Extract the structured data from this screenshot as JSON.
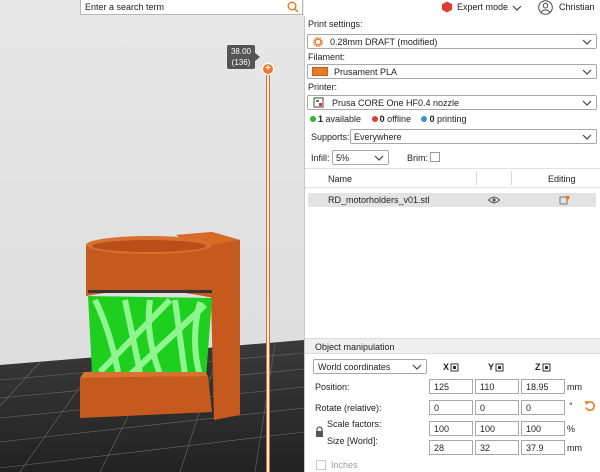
{
  "search": {
    "placeholder": "Enter a search term"
  },
  "slider": {
    "height": "38.00",
    "layer": "(136)"
  },
  "topbar": {
    "mode_label": "Expert mode",
    "user_name": "Christian"
  },
  "print_settings": {
    "label": "Print settings:",
    "value": "0.28mm DRAFT (modified)"
  },
  "filament": {
    "label": "Filament:",
    "value": "Prusament PLA",
    "color": "#ea7a28"
  },
  "printer": {
    "label": "Printer:",
    "value": "Prusa CORE One HF0.4 nozzle",
    "status": {
      "available": "1",
      "available_text": "available",
      "offline": "0",
      "offline_text": "offline",
      "printing": "0",
      "printing_text": "printing"
    }
  },
  "supports": {
    "label": "Supports:",
    "value": "Everywhere"
  },
  "infill": {
    "label": "Infill:",
    "value": "5%"
  },
  "brim": {
    "label": "Brim:",
    "checked": false
  },
  "object_list": {
    "col_name": "Name",
    "col_editing": "Editing",
    "items": [
      {
        "name": "RD_motorholders_v01.stl"
      }
    ]
  },
  "object_manipulation": {
    "title": "Object manipulation",
    "coord_system": "World coordinates",
    "axes": [
      "X",
      "Y",
      "Z"
    ],
    "position": {
      "label": "Position:",
      "x": "125",
      "y": "110",
      "z": "18.95",
      "unit": "mm"
    },
    "rotate": {
      "label": "Rotate (relative):",
      "x": "0",
      "y": "0",
      "z": "0",
      "unit": "°"
    },
    "scale": {
      "label": "Scale factors:",
      "x": "100",
      "y": "100",
      "z": "100",
      "unit": "%"
    },
    "size": {
      "label": "Size [World]:",
      "x": "28",
      "y": "32",
      "z": "37.9",
      "unit": "mm"
    },
    "inches_label": "Inches"
  },
  "colors": {
    "accent": "#ea7a28",
    "model": "#c65a1e",
    "support": "#22dd22"
  }
}
